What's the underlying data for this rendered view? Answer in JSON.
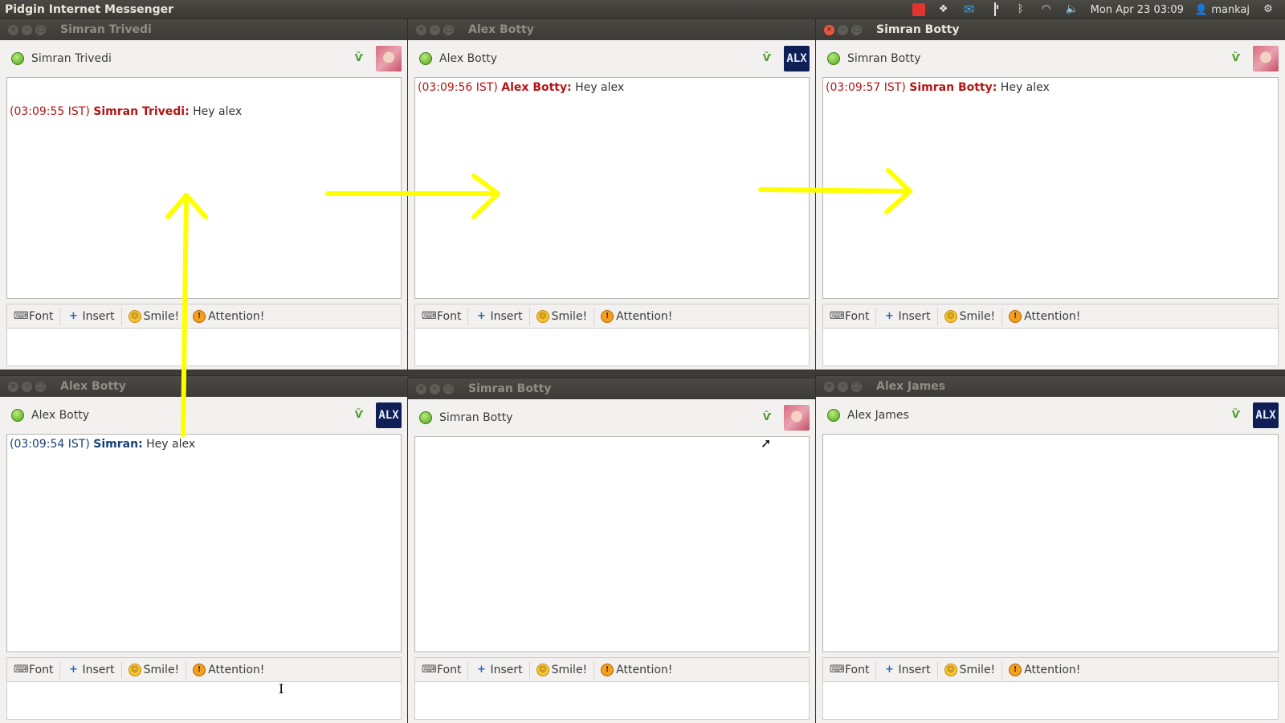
{
  "topbar": {
    "app_title": "Pidgin Internet Messenger",
    "datetime": "Mon Apr 23 03:09",
    "user": "mankaj",
    "icons": [
      "record-indicator-icon",
      "dropbox-icon",
      "mail-icon",
      "battery-icon",
      "bluetooth-icon",
      "wifi-icon",
      "volume-icon",
      "user-icon",
      "gear-icon"
    ]
  },
  "toolbar_labels": {
    "font": "Font",
    "insert": "Insert",
    "smile": "Smile!",
    "attention": "Attention!"
  },
  "windows": [
    {
      "title": "Simran Trivedi",
      "contact": "Simran Trivedi",
      "avatar": "girl",
      "active": false,
      "messages": [
        {
          "time": "(03:09:55  IST)",
          "sender": "Simran Trivedi:",
          "text": "Hey alex",
          "self": false
        }
      ]
    },
    {
      "title": "Alex Botty",
      "contact": "Alex Botty",
      "avatar": "ALX",
      "active": false,
      "messages": [
        {
          "time": "(03:09:56  IST)",
          "sender": "Alex Botty:",
          "text": "Hey alex",
          "self": false
        }
      ]
    },
    {
      "title": "Simran Botty",
      "contact": "Simran Botty",
      "avatar": "girl",
      "active": true,
      "messages": [
        {
          "time": "(03:09:57  IST)",
          "sender": "Simran Botty:",
          "text": "Hey alex",
          "self": false
        }
      ]
    },
    {
      "title": "Alex Botty",
      "contact": "Alex Botty",
      "avatar": "ALX",
      "active": false,
      "messages": [
        {
          "time": "(03:09:54  IST)",
          "sender": "Simran:",
          "text": "Hey alex",
          "self": true
        }
      ]
    },
    {
      "title": "Simran Botty",
      "contact": "Simran Botty",
      "avatar": "girl",
      "active": false,
      "messages": []
    },
    {
      "title": "Alex James",
      "contact": "Alex James",
      "avatar": "ALX",
      "active": false,
      "messages": []
    }
  ],
  "colors": {
    "annotation_arrow": "#ffff00",
    "incoming_sender": "#b51515",
    "own_sender": "#16407a"
  }
}
